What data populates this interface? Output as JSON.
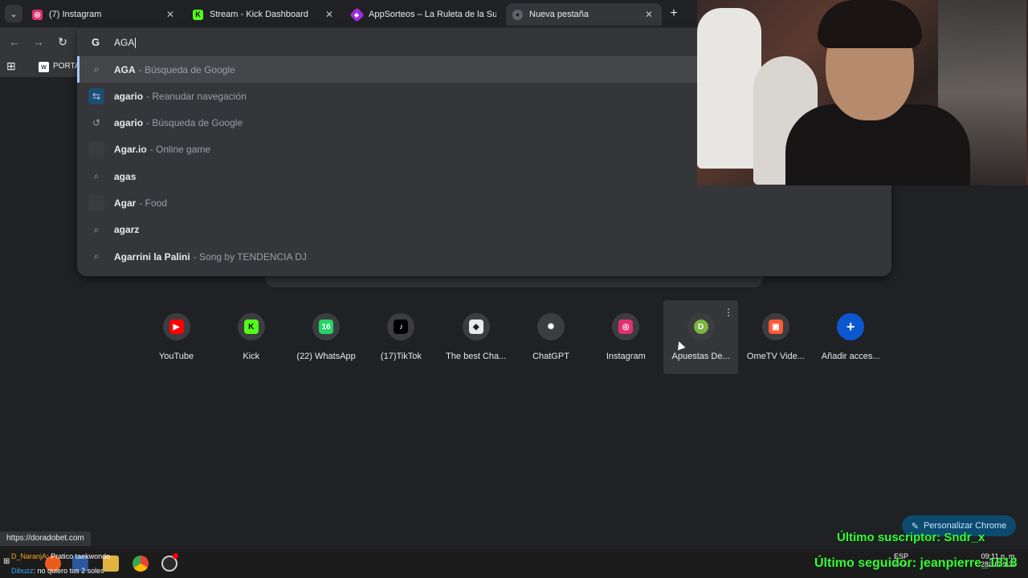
{
  "tabs": [
    {
      "title": "(7) Instagram",
      "icon": "instagram-icon",
      "color": "#e1306c"
    },
    {
      "title": "Stream - Kick Dashboard",
      "icon": "kick-icon",
      "color": "#53fc18"
    },
    {
      "title": "AppSorteos – La Ruleta de la Su",
      "icon": "appsorteos-icon",
      "color": "#a02bdb"
    },
    {
      "title": "Nueva pestaña",
      "icon": "chrome-icon",
      "color": "#bdc1c6"
    }
  ],
  "tab_close": "✕",
  "new_tab": "+",
  "toolbar": {
    "back": "←",
    "forward": "→",
    "reload": "↻",
    "google_g": "G"
  },
  "bookmarks": {
    "apps": "⊞",
    "item": "PORTA",
    "item_fav": "w"
  },
  "omnibox": {
    "query": "AGA",
    "suggestions": [
      {
        "icon": "search-icon",
        "bold": "AGA",
        "rest": "",
        "sub": "- Búsqueda de Google",
        "selected": true
      },
      {
        "icon": "tab-group-icon",
        "bold": "aga",
        "rest": "rio",
        "sub": "- Reanudar navegación"
      },
      {
        "icon": "history-icon",
        "bold": "aga",
        "rest": "rio",
        "sub": "- Búsqueda de Google"
      },
      {
        "icon": "site-icon",
        "bold": "Aga",
        "rest": "r.io",
        "sub": "- Online game"
      },
      {
        "icon": "search-icon",
        "bold": "aga",
        "rest": "s",
        "sub": ""
      },
      {
        "icon": "site-icon",
        "bold": "Aga",
        "rest": "r",
        "sub": "- Food"
      },
      {
        "icon": "search-icon",
        "bold": "aga",
        "rest": "rz",
        "sub": ""
      },
      {
        "icon": "search-icon",
        "bold": "Aga",
        "rest": "rrini la Palini",
        "sub": "- Song by TENDENCIA DJ"
      }
    ]
  },
  "shortcuts": [
    {
      "label": "YouTube",
      "icon": "youtube-icon",
      "color": "#ff0000",
      "glyph": "▶"
    },
    {
      "label": "Kick",
      "icon": "kick-icon",
      "color": "#53fc18",
      "glyph": "K"
    },
    {
      "label": "(22) WhatsApp",
      "icon": "whatsapp-icon",
      "color": "#25d366",
      "glyph": "16"
    },
    {
      "label": "(17)TikTok",
      "icon": "tiktok-icon",
      "color": "#000000",
      "glyph": "♪"
    },
    {
      "label": "The best Cha...",
      "icon": "discord-icon",
      "color": "#e8eaed",
      "glyph": "◆"
    },
    {
      "label": "ChatGPT",
      "icon": "chatgpt-icon",
      "color": "#3c3d40",
      "glyph": "✺"
    },
    {
      "label": "Instagram",
      "icon": "instagram-icon",
      "color": "#e1306c",
      "glyph": "◎"
    },
    {
      "label": "Apuestas De...",
      "icon": "letter-d-icon",
      "color": "#7cb342",
      "glyph": "D"
    },
    {
      "label": "OmeTV Vide...",
      "icon": "ometv-icon",
      "color": "#ff5a36",
      "glyph": "▣"
    },
    {
      "label": "Añadir acces...",
      "icon": "plus-icon",
      "color": "#0b57d0",
      "glyph": "+"
    }
  ],
  "status_url": "https://doradobet.com",
  "customize_label": "Personalizar Chrome",
  "overlay": {
    "subscriber": "Último suscriptor: Sndr_x",
    "follower": "Último seguidor: jeanpierre_1818"
  },
  "chat": [
    {
      "user": "D_NaranjA",
      "sep": ":",
      "text": "Pratico taekwondo"
    },
    {
      "user": "Dibuzz",
      "sep": ":",
      "text": "no quiero tus 2 soles"
    }
  ],
  "tray": {
    "lang": "ESP",
    "lang2": "LAA",
    "time": "09:11 p. m.",
    "date": "28/10/2024"
  }
}
